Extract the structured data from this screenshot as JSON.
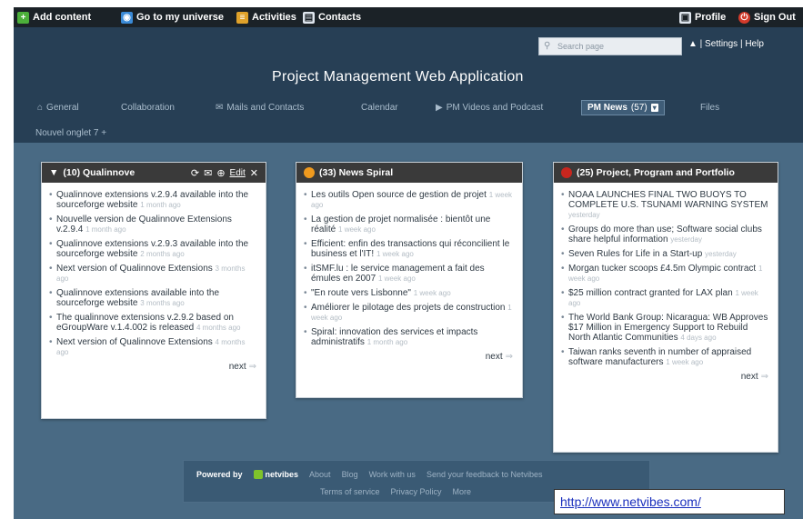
{
  "topbar": {
    "add_content": "Add content",
    "go_universe": "Go to my universe",
    "activities": "Activities",
    "contacts": "Contacts",
    "profile": "Profile",
    "sign_out": "Sign Out"
  },
  "header": {
    "search_placeholder": "Search page",
    "settings_help": "▲  | Settings | Help",
    "title": "Project Management Web Application"
  },
  "tabs": [
    {
      "label": "General"
    },
    {
      "label": "Collaboration"
    },
    {
      "label": "Mails and Contacts"
    },
    {
      "label": "Calendar"
    },
    {
      "label": "PM Videos and Podcast"
    },
    {
      "label": "PM News",
      "count": "(57)"
    },
    {
      "label": "Files"
    }
  ],
  "subtabs": "Nouvel onglet 7   +",
  "widgets": [
    {
      "title": "(10) Qualinnove",
      "edit": "Edit",
      "items": [
        {
          "text": "Qualinnove extensions v.2.9.4 available into the sourceforge website",
          "time": "1 month ago"
        },
        {
          "text": "Nouvelle version de Qualinnove Extensions v.2.9.4",
          "time": "1 month ago"
        },
        {
          "text": "Qualinnove extensions v.2.9.3 available into the sourceforge website",
          "time": "2 months ago"
        },
        {
          "text": "Next version of Qualinnove Extensions",
          "time": "3 months ago"
        },
        {
          "text": "Qualinnove extensions available into the sourceforge website",
          "time": "3 months ago"
        },
        {
          "text": "The qualinnove extensions v.2.9.2 based on eGroupWare v.1.4.002 is released",
          "time": "4 months ago"
        },
        {
          "text": "Next version of Qualinnove Extensions",
          "time": "4 months ago"
        }
      ],
      "next": "next"
    },
    {
      "title": "(33) News Spiral",
      "items": [
        {
          "text": "Les outils Open source de gestion de projet",
          "time": "1 week ago"
        },
        {
          "text": "La gestion de projet normalisée : bientôt une réalité",
          "time": "1 week ago"
        },
        {
          "text": "Efficient: enfin des transactions qui réconcilient le business et l'IT!",
          "time": "1 week ago"
        },
        {
          "text": "itSMF.lu : le service management a fait des émules en 2007",
          "time": "1 week ago"
        },
        {
          "text": "\"En route vers Lisbonne\"",
          "time": "1 week ago"
        },
        {
          "text": "Améliorer le pilotage des projets de construction",
          "time": "1 week ago"
        },
        {
          "text": "Spiral: innovation des services et impacts administratifs",
          "time": "1 month ago"
        }
      ],
      "next": "next"
    },
    {
      "title": "(25) Project, Program and Portfolio",
      "items": [
        {
          "text": "NOAA LAUNCHES FINAL TWO BUOYS TO COMPLETE U.S. TSUNAMI WARNING SYSTEM",
          "time": "yesterday"
        },
        {
          "text": "Groups do more than use; Software social clubs share helpful information",
          "time": "yesterday"
        },
        {
          "text": "Seven Rules for Life in a Start-up",
          "time": "yesterday"
        },
        {
          "text": "Morgan tucker scoops £4.5m Olympic contract",
          "time": "1 week ago"
        },
        {
          "text": "$25 million contract granted for LAX plan",
          "time": "1 week ago"
        },
        {
          "text": "The World Bank Group: Nicaragua: WB Approves $17 Million in Emergency Support to Rebuild North Atlantic Communities",
          "time": "4 days ago"
        },
        {
          "text": "Taiwan ranks seventh in number of appraised software manufacturers",
          "time": "1 week ago"
        }
      ],
      "next": "next"
    }
  ],
  "footer": {
    "powered_by": "Powered by",
    "brand": "netvibes",
    "links_row1": [
      "About",
      "Blog",
      "Work with us",
      "Send your feedback to Netvibes"
    ],
    "links_row2": [
      "Terms of service",
      "Privacy Policy",
      "More"
    ]
  },
  "url_label": "http://www.netvibes.com/",
  "colors": {
    "page_bg": "#496a84",
    "header_bg": "#273f55",
    "topbar_bg": "#1b2227",
    "widget_header": "#3a3a3a"
  }
}
